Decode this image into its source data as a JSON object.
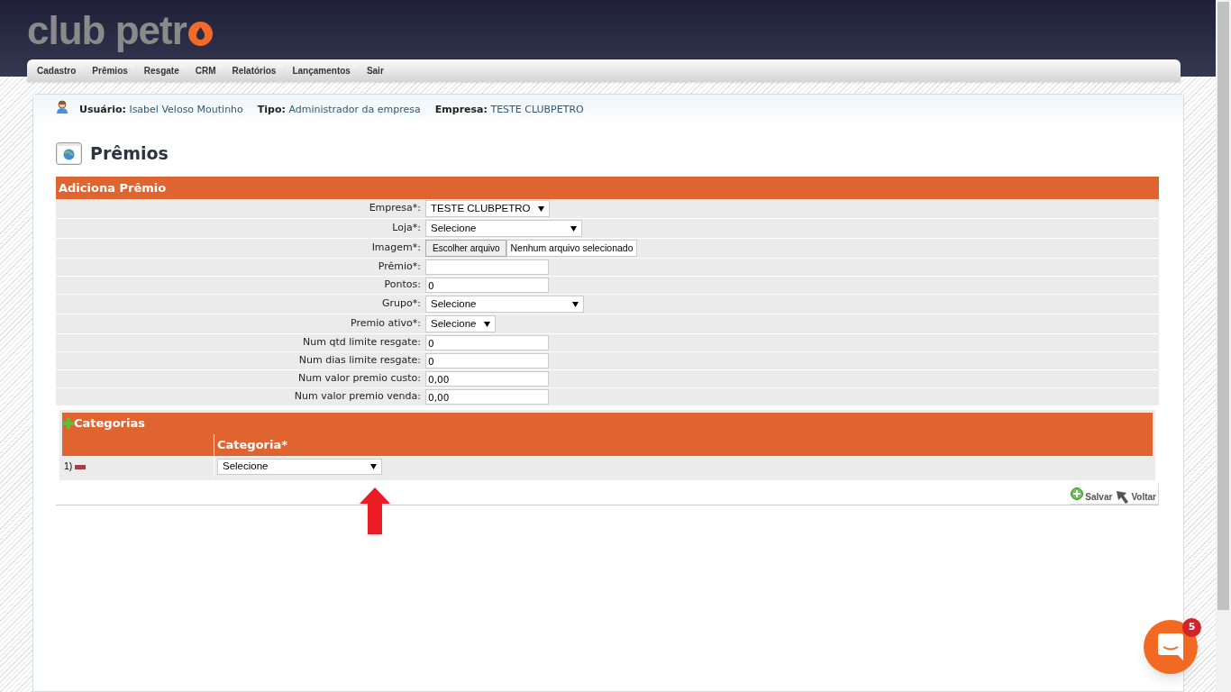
{
  "logo": "club petr",
  "menu": [
    {
      "label": "Cadastro",
      "dropdown": true
    },
    {
      "label": "Prêmios",
      "dropdown": true
    },
    {
      "label": "Resgate",
      "dropdown": true
    },
    {
      "label": "CRM",
      "dropdown": true
    },
    {
      "label": "Relatórios",
      "dropdown": true
    },
    {
      "label": "Lançamentos",
      "dropdown": true
    },
    {
      "label": "Sair",
      "dropdown": false
    }
  ],
  "user_bar": [
    {
      "label": "Usuário:",
      "value": "Isabel Veloso Moutinho"
    },
    {
      "label": "Tipo:",
      "value": "Administrador da empresa"
    },
    {
      "label": "Empresa:",
      "value": "TESTE CLUBPETRO"
    }
  ],
  "page_title": "Prêmios",
  "form": {
    "title": "Adiciona Prêmio",
    "fields": [
      {
        "label": "Empresa*:",
        "kind": "select",
        "value": "TESTE CLUBPETRO"
      },
      {
        "label": "Loja*:",
        "kind": "select",
        "value": "Selecione"
      },
      {
        "label": "Imagem*:",
        "kind": "file",
        "button": "Escolher arquivo",
        "value": "Nenhum arquivo selecionado"
      },
      {
        "label": "Prêmio*:",
        "kind": "text"
      },
      {
        "label": "Pontos:",
        "kind": "text",
        "value": "0"
      },
      {
        "label": "Grupo*:",
        "kind": "select",
        "value": "Selecione"
      },
      {
        "label": "Premio ativo*:",
        "kind": "select",
        "value": "Selecione"
      },
      {
        "label": "Num qtd limite resgate:",
        "kind": "text",
        "value": "0"
      },
      {
        "label": "Num dias limite resgate:",
        "kind": "text",
        "value": "0"
      },
      {
        "label": "Num valor premio custo:",
        "kind": "text",
        "value": "0,00"
      },
      {
        "label": "Num valor premio venda:",
        "kind": "text",
        "value": "0,00"
      }
    ]
  },
  "categories": {
    "title": "Categorias",
    "column": "Categoria*",
    "rows": [
      {
        "number": "1)",
        "value": "Selecione"
      }
    ]
  },
  "actions": [
    "Salvar",
    "Voltar"
  ],
  "chat": {
    "badge": "5"
  }
}
